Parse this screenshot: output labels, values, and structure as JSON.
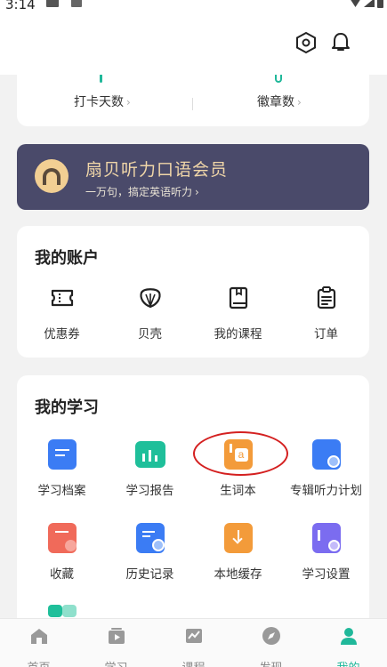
{
  "status_bar": {
    "time": "3:14"
  },
  "header": {},
  "stats": [
    {
      "label": "打卡天数"
    },
    {
      "label": "徽章数"
    }
  ],
  "vip": {
    "title": "扇贝听力口语会员",
    "subtitle": "一万句，搞定英语听力"
  },
  "account": {
    "title": "我的账户",
    "items": [
      {
        "label": "优惠券",
        "icon": "coupon-icon"
      },
      {
        "label": "贝壳",
        "icon": "shell-icon"
      },
      {
        "label": "我的课程",
        "icon": "book-icon"
      },
      {
        "label": "订单",
        "icon": "clipboard-icon"
      }
    ]
  },
  "study": {
    "title": "我的学习",
    "items": [
      {
        "label": "学习档案",
        "icon": "file-icon",
        "color": "#3b7cf4"
      },
      {
        "label": "学习报告",
        "icon": "bar-chart-icon",
        "color": "#1fbf9a"
      },
      {
        "label": "生词本",
        "icon": "vocabulary-book-icon",
        "color": "#f39b3a"
      },
      {
        "label": "专辑听力计划",
        "icon": "plan-icon",
        "color": "#3b7cf4"
      },
      {
        "label": "收藏",
        "icon": "heart-icon",
        "color": "#f06a5a"
      },
      {
        "label": "历史记录",
        "icon": "history-icon",
        "color": "#3b7cf4"
      },
      {
        "label": "本地缓存",
        "icon": "download-icon",
        "color": "#f39b3a"
      },
      {
        "label": "学习设置",
        "icon": "settings-icon",
        "color": "#7b6cf0"
      }
    ]
  },
  "tabs": [
    {
      "label": "首页",
      "icon": "home-icon",
      "active": false
    },
    {
      "label": "学习",
      "icon": "play-icon",
      "active": false
    },
    {
      "label": "课程",
      "icon": "course-icon",
      "active": false
    },
    {
      "label": "发现",
      "icon": "compass-icon",
      "active": false
    },
    {
      "label": "我的",
      "icon": "profile-icon",
      "active": true
    }
  ],
  "colors": {
    "accent": "#20b89a",
    "highlight": "#d42020"
  }
}
